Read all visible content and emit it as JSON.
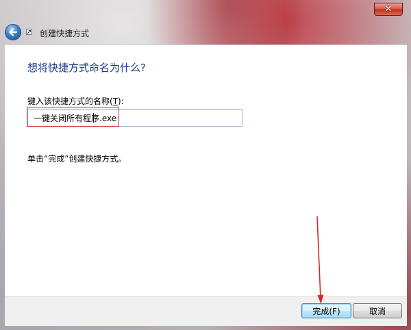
{
  "window": {
    "title": "创建快捷方式",
    "close_icon": "close-icon",
    "back_icon": "back-arrow-icon",
    "accent": "#1c3a8a"
  },
  "main": {
    "heading": "想将快捷方式命名为什么?",
    "field_label_prefix": "键入该快捷方式的名称(",
    "field_label_key": "T",
    "field_label_suffix": "):",
    "name_value": "一键关闭所有程序.exe",
    "hint": "单击“完成”创建快捷方式。",
    "highlight_color": "#d22a2a"
  },
  "footer": {
    "finish_label": "完成(F)",
    "cancel_label": "取消"
  }
}
